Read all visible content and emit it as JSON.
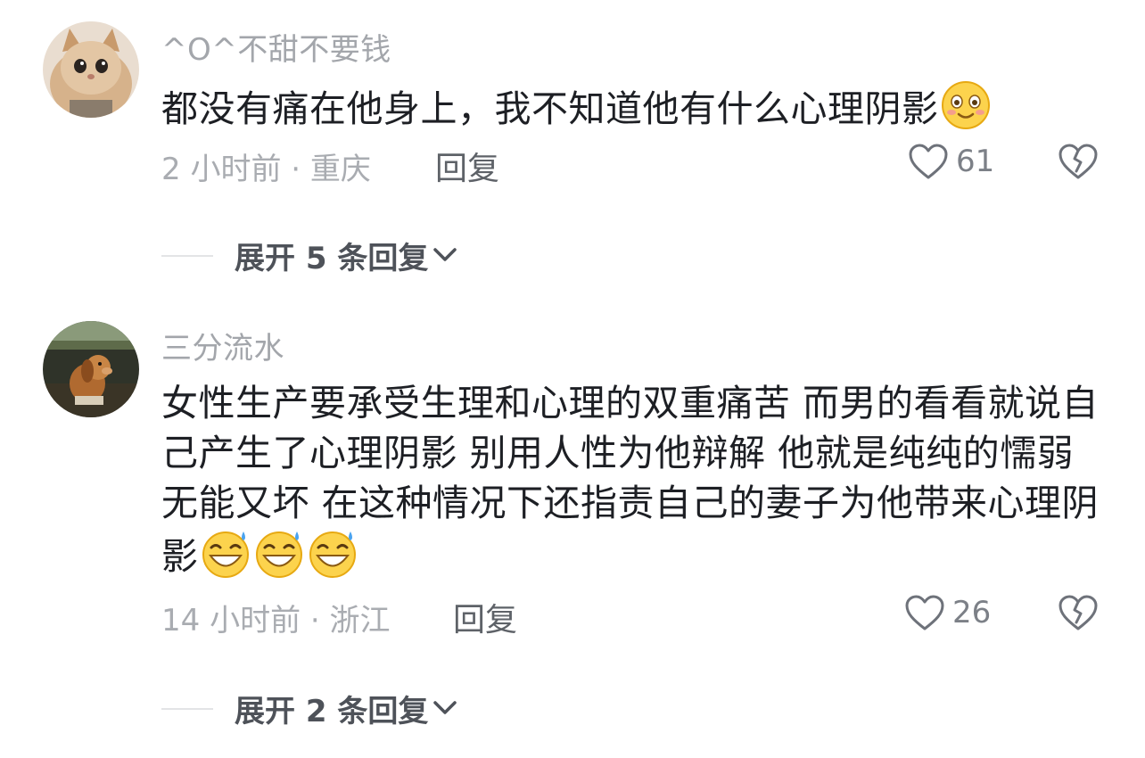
{
  "comments": [
    {
      "username": "^O^不甜不要钱",
      "avatar": "kitten-avatar",
      "text": "都没有痛在他身上，我不知道他有什么心理阴影",
      "emojis": [
        "blushing-smile-emoji"
      ],
      "meta": "2 小时前 · 重庆",
      "reply_label": "回复",
      "likes": "61",
      "expand_label": "展开 5 条回复"
    },
    {
      "username": "三分流水",
      "avatar": "dog-figurine-avatar",
      "text": "女性生产要承受生理和心理的双重痛苦 而男的看看就说自己产生了心理阴影 别用人性为他辩解 他就是纯纯的懦弱无能又坏 在这种情况下还指责自己的妻子为他带来心理阴影",
      "emojis": [
        "grinning-sweat-emoji",
        "grinning-sweat-emoji",
        "grinning-sweat-emoji"
      ],
      "meta": "14 小时前 · 浙江",
      "reply_label": "回复",
      "likes": "26",
      "expand_label": "展开 2 条回复"
    }
  ],
  "icons": {
    "like": "heart-outline-icon",
    "dislike": "broken-heart-icon",
    "expand": "chevron-down-icon"
  },
  "colors": {
    "username": "#a3a6ab",
    "text": "#1d1f24",
    "meta": "#a9acb1",
    "icon": "#6e727a"
  }
}
